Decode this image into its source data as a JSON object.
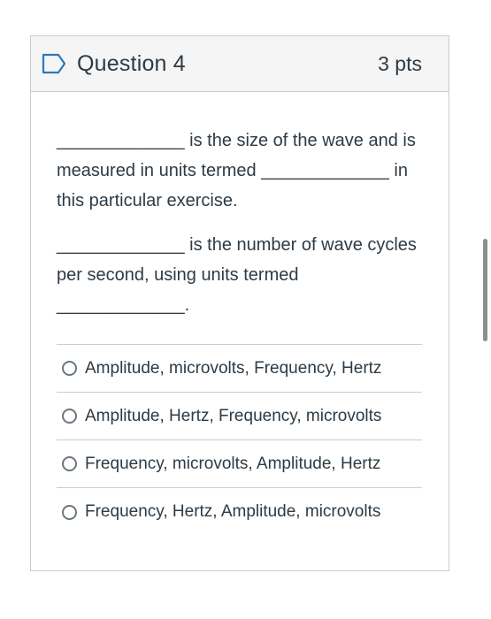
{
  "question": {
    "title": "Question 4",
    "points": "3 pts",
    "paragraphs": [
      "_____________ is the size of the wave and is measured in units termed _____________ in this particular exercise.",
      "_____________ is the number of wave cycles per second, using units termed _____________."
    ],
    "answers": [
      "Amplitude, microvolts, Frequency, Hertz",
      "Amplitude, Hertz, Frequency, microvolts",
      "Frequency, microvolts, Amplitude, Hertz",
      "Frequency, Hertz, Amplitude, microvolts"
    ]
  },
  "colors": {
    "flag_icon": "#2b7abc",
    "header_bg": "#f5f5f5",
    "border": "#c7cdd1",
    "text": "#2d3b45"
  },
  "icons": {
    "flag": "bookmark-flag-icon",
    "radio": "radio-unchecked-icon"
  }
}
